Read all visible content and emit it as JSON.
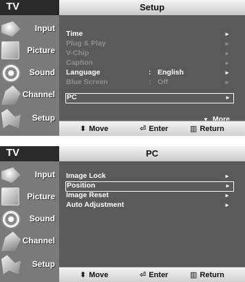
{
  "tv_label": "TV",
  "sidebar": [
    {
      "label": "Input",
      "icon": "input-icon"
    },
    {
      "label": "Picture",
      "icon": "picture-icon"
    },
    {
      "label": "Sound",
      "icon": "sound-icon"
    },
    {
      "label": "Channel",
      "icon": "channel-icon"
    },
    {
      "label": "Setup",
      "icon": "setup-icon"
    }
  ],
  "footer": {
    "move": "Move",
    "enter": "Enter",
    "return": "Return",
    "move_glyph": "⬍",
    "enter_glyph": "⏎",
    "return_glyph": "▥"
  },
  "arrow_glyph": "►",
  "setup_menu": {
    "title": "Setup",
    "more": "More",
    "more_glyph": "▼",
    "items": [
      {
        "label": "Time",
        "value": "",
        "sep": "",
        "enabled": true,
        "selected": false
      },
      {
        "label": "Plug & Play",
        "value": "",
        "sep": "",
        "enabled": false,
        "selected": false
      },
      {
        "label": "V-Chip",
        "value": "",
        "sep": "",
        "enabled": false,
        "selected": false
      },
      {
        "label": "Caption",
        "value": "",
        "sep": "",
        "enabled": false,
        "selected": false
      },
      {
        "label": "Language",
        "value": "English",
        "sep": ":",
        "enabled": true,
        "selected": false
      },
      {
        "label": "Blue Screen",
        "value": "Off",
        "sep": ":",
        "enabled": false,
        "selected": false
      },
      {
        "label": "PC",
        "value": "",
        "sep": "",
        "enabled": true,
        "selected": true
      }
    ]
  },
  "pc_menu": {
    "title": "PC",
    "items": [
      {
        "label": "Image Lock",
        "enabled": true,
        "selected": false
      },
      {
        "label": "Position",
        "enabled": true,
        "selected": true
      },
      {
        "label": "Image Reset",
        "enabled": true,
        "selected": false
      },
      {
        "label": "Auto Adjustment",
        "enabled": true,
        "selected": false
      }
    ]
  }
}
